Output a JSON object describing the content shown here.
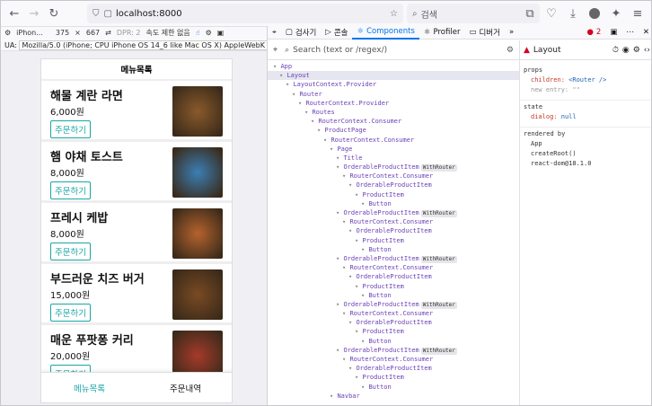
{
  "browser": {
    "url": "localhost:8000",
    "search_placeholder": "검색"
  },
  "rdm": {
    "device": "iPhon...",
    "width": "375",
    "x": "×",
    "height": "667",
    "dpr": "DPR: 2",
    "throttle": "속도 제한 없음",
    "ua_label": "UA:",
    "ua_value": "Mozilla/5.0 (iPhone; CPU iPhone OS 14_6 like Mac OS X) AppleWebK"
  },
  "app": {
    "title": "메뉴목록",
    "order_label": "주문하기",
    "items": [
      {
        "name": "해물 계란 라면",
        "price": "6,000원",
        "color": "#8a5a2b"
      },
      {
        "name": "햄 야채 토스트",
        "price": "8,000원",
        "color": "#3b7fb5"
      },
      {
        "name": "프레시 케밥",
        "price": "8,000원",
        "color": "#b5632d"
      },
      {
        "name": "부드러운 치즈 버거",
        "price": "15,000원",
        "color": "#7a4a23"
      },
      {
        "name": "매운 푸팟퐁 커리",
        "price": "20,000원",
        "color": "#a53a2a"
      }
    ],
    "tabs": [
      "메뉴목록",
      "주문내역"
    ]
  },
  "devtools": {
    "tabs": [
      "검사기",
      "콘솔",
      "Components",
      "Profiler",
      "디버거"
    ],
    "badge": "2",
    "search_placeholder": "Search (text or /regex/)",
    "selected": "Layout",
    "tree": [
      {
        "d": 0,
        "n": "App",
        "wr": false
      },
      {
        "d": 1,
        "n": "Layout",
        "wr": false
      },
      {
        "d": 2,
        "n": "LayoutContext.Provider",
        "wr": false
      },
      {
        "d": 3,
        "n": "Router",
        "wr": false
      },
      {
        "d": 4,
        "n": "RouterContext.Provider",
        "wr": false
      },
      {
        "d": 5,
        "n": "Routes",
        "wr": false
      },
      {
        "d": 6,
        "n": "RouterContext.Consumer",
        "wr": false
      },
      {
        "d": 7,
        "n": "ProductPage",
        "wr": false
      },
      {
        "d": 8,
        "n": "RouterContext.Consumer",
        "wr": false
      },
      {
        "d": 9,
        "n": "Page",
        "wr": false
      },
      {
        "d": 10,
        "n": "Title",
        "wr": false
      },
      {
        "d": 10,
        "n": "OrderableProductItem",
        "wr": true
      },
      {
        "d": 11,
        "n": "RouterContext.Consumer",
        "wr": false
      },
      {
        "d": 12,
        "n": "OrderableProductItem",
        "wr": false
      },
      {
        "d": 13,
        "n": "ProductItem",
        "wr": false
      },
      {
        "d": 14,
        "n": "Button",
        "wr": false
      },
      {
        "d": 10,
        "n": "OrderableProductItem",
        "wr": true
      },
      {
        "d": 11,
        "n": "RouterContext.Consumer",
        "wr": false
      },
      {
        "d": 12,
        "n": "OrderableProductItem",
        "wr": false
      },
      {
        "d": 13,
        "n": "ProductItem",
        "wr": false
      },
      {
        "d": 14,
        "n": "Button",
        "wr": false
      },
      {
        "d": 10,
        "n": "OrderableProductItem",
        "wr": true
      },
      {
        "d": 11,
        "n": "RouterContext.Consumer",
        "wr": false
      },
      {
        "d": 12,
        "n": "OrderableProductItem",
        "wr": false
      },
      {
        "d": 13,
        "n": "ProductItem",
        "wr": false
      },
      {
        "d": 14,
        "n": "Button",
        "wr": false
      },
      {
        "d": 10,
        "n": "OrderableProductItem",
        "wr": true
      },
      {
        "d": 11,
        "n": "RouterContext.Consumer",
        "wr": false
      },
      {
        "d": 12,
        "n": "OrderableProductItem",
        "wr": false
      },
      {
        "d": 13,
        "n": "ProductItem",
        "wr": false
      },
      {
        "d": 14,
        "n": "Button",
        "wr": false
      },
      {
        "d": 10,
        "n": "OrderableProductItem",
        "wr": true
      },
      {
        "d": 11,
        "n": "RouterContext.Consumer",
        "wr": false
      },
      {
        "d": 12,
        "n": "OrderableProductItem",
        "wr": false
      },
      {
        "d": 13,
        "n": "ProductItem",
        "wr": false
      },
      {
        "d": 14,
        "n": "Button",
        "wr": false
      },
      {
        "d": 9,
        "n": "Navbar",
        "wr": false
      }
    ],
    "withrouter": "WithRouter",
    "side": {
      "props_label": "props",
      "children_key": "children:",
      "children_val": "<Router />",
      "newentry_key": "new entry:",
      "newentry_val": "\"\"",
      "state_label": "state",
      "dialog_key": "dialog:",
      "dialog_val": "null",
      "rendered_label": "rendered by",
      "rendered": [
        "App",
        "createRoot()",
        "react-dom@18.1.0"
      ]
    }
  }
}
